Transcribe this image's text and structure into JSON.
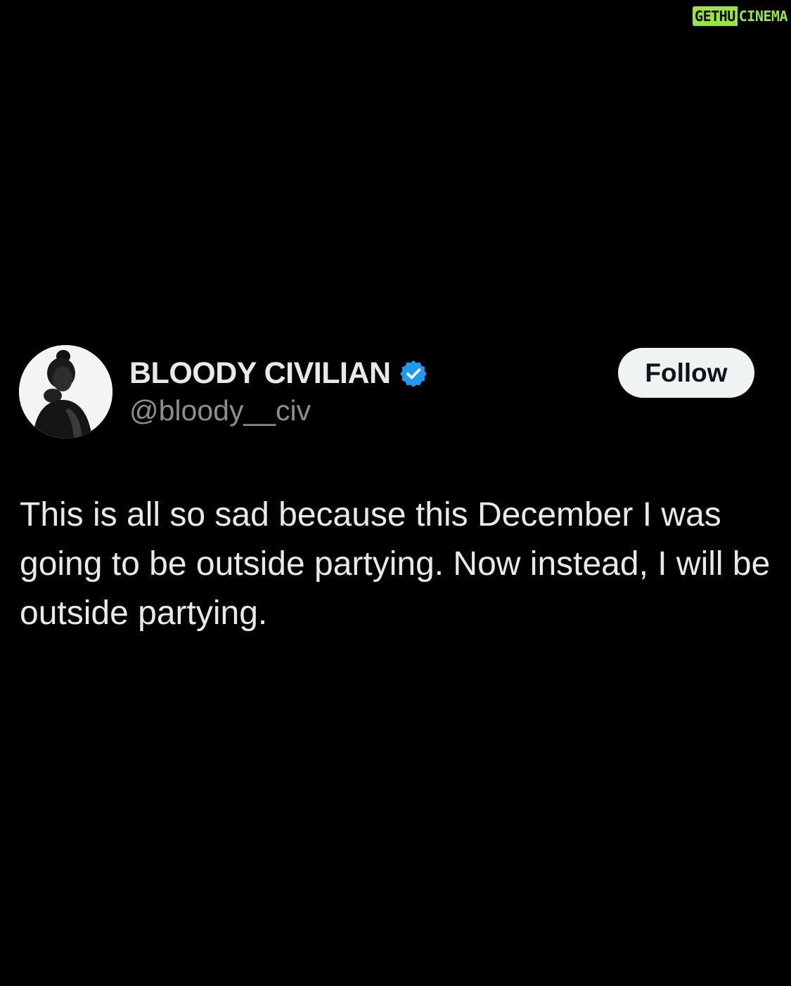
{
  "watermark": {
    "part1": "GETHU",
    "part2": "CINEMA"
  },
  "tweet": {
    "display_name": "BLOODY CIVILIAN",
    "handle": "@bloody__civ",
    "verified": true,
    "follow_label": "Follow",
    "text": "This is all so sad because this December I was going to be outside partying. Now instead, I will be outside partying."
  },
  "colors": {
    "background": "#000000",
    "text_primary": "#e7e9ea",
    "text_secondary": "#8b8f94",
    "verified_blue": "#1d9bf0",
    "follow_bg": "#eff3f4",
    "follow_text": "#0f1419",
    "watermark_green": "#9be63a"
  },
  "icons": {
    "avatar": "profile-photo",
    "badge": "verified-badge-icon"
  }
}
